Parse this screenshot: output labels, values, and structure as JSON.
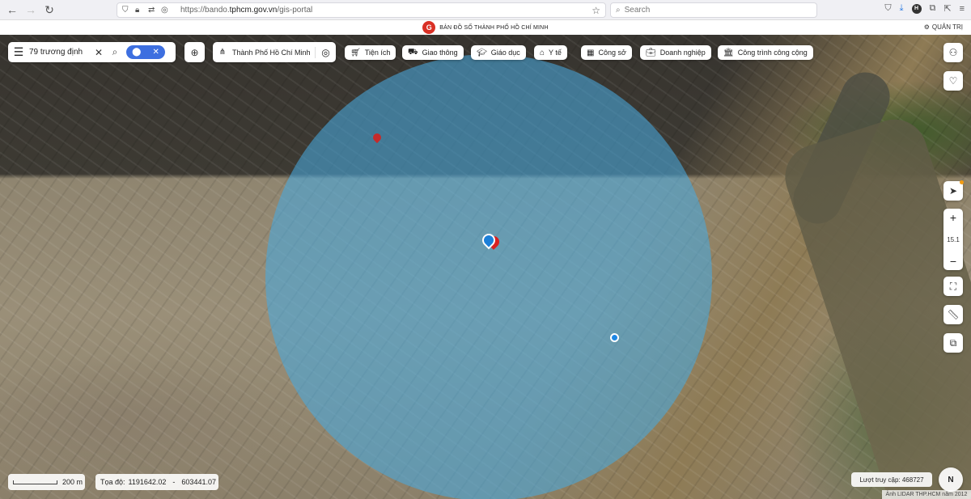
{
  "browser": {
    "url_prefix": "https://bando.",
    "url_domain": "tphcm.gov.vn",
    "url_path": "/gis-portal",
    "search_placeholder": "Search",
    "profile_initial": "H"
  },
  "portal": {
    "title": "BẢN ĐỒ SỐ THÀNH PHỐ HỒ CHÍ MINH",
    "admin_label": "QUẢN TRỊ"
  },
  "search": {
    "value": "79 trương định"
  },
  "city_select": {
    "label": "Thành Phố Hồ Chí Minh"
  },
  "categories": [
    {
      "label": "Tiện ích",
      "icon": "cart-icon"
    },
    {
      "label": "Giao thông",
      "icon": "bus-icon"
    },
    {
      "label": "Giáo dục",
      "icon": "graduation-cap-icon"
    },
    {
      "label": "Y tế",
      "icon": "hospital-icon"
    },
    {
      "label": "Công sở",
      "icon": "building-icon"
    },
    {
      "label": "Doanh nghiệp",
      "icon": "briefcase-icon"
    },
    {
      "label": "Công trình công cộng",
      "icon": "landmark-icon"
    }
  ],
  "map": {
    "zoom_level": "15.1",
    "scale_label": "200 m",
    "coord_label": "Tọa độ:",
    "coord_x": "1191642.02",
    "coord_sep": "-",
    "coord_y": "603441.07",
    "visits_label": "Lượt truy cập:",
    "visits_count": "468727",
    "compass_label": "N",
    "attribution": "Ảnh LIDAR THP.HCM năm 2012"
  }
}
